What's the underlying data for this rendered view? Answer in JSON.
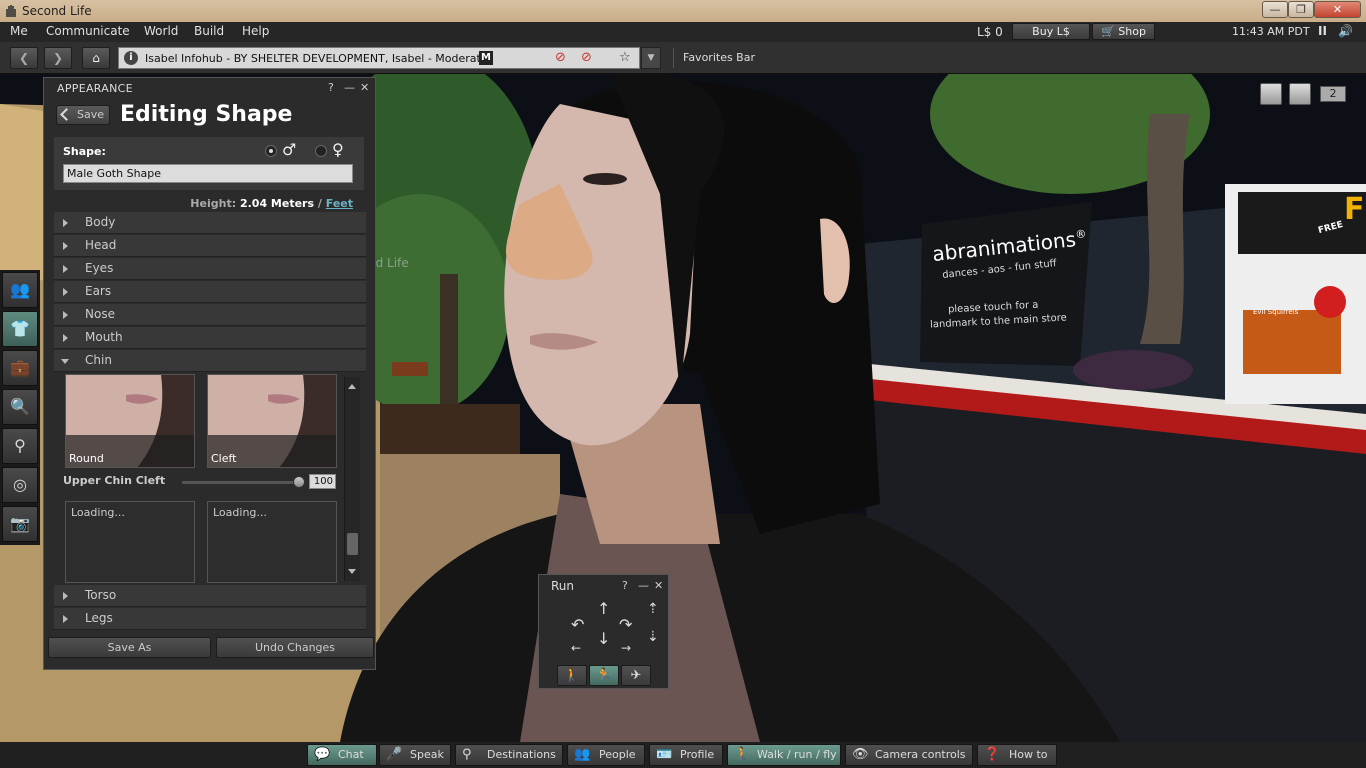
{
  "window": {
    "title": "Second Life",
    "minimize": "—",
    "maximize": "❐",
    "close": "✕"
  },
  "menubar": {
    "items": [
      "Me",
      "Communicate",
      "World",
      "Build",
      "Help"
    ],
    "balance": "L$ 0",
    "buy_label": "Buy L$",
    "shop_label": "Shop",
    "clock": "11:43 AM PDT",
    "pause": "II",
    "volume": "🔊"
  },
  "navbar": {
    "location": "Isabel Infohub - BY SHELTER DEVELOPMENT, Isabel - Moderate",
    "rating": "M",
    "favorites": "Favorites Bar"
  },
  "appearance": {
    "panel_title": "APPEARANCE",
    "help": "?",
    "minimize": "—",
    "close": "✕",
    "save_label": "Save",
    "editing_title": "Editing Shape",
    "shape_label": "Shape:",
    "male_symbol": "♂",
    "female_symbol": "♀",
    "shape_name": "Male Goth Shape",
    "height_label": "Height:",
    "height_value": "2.04 Meters",
    "height_sep": "/",
    "feet_link": "Feet",
    "sections": [
      "Body",
      "Head",
      "Eyes",
      "Ears",
      "Nose",
      "Mouth",
      "Chin"
    ],
    "chin": {
      "thumb_left": "Round",
      "thumb_right": "Cleft",
      "slider_label": "Upper Chin Cleft",
      "slider_value": "100",
      "slider_fraction": 1.0,
      "loading_left": "Loading...",
      "loading_right": "Loading..."
    },
    "sections_after": [
      "Torso",
      "Legs"
    ],
    "save_as": "Save As",
    "undo": "Undo Changes"
  },
  "run_panel": {
    "title": "Run",
    "help": "?",
    "minimize": "—",
    "close": "✕"
  },
  "world": {
    "sign_brand": "abranimations",
    "sign_reg": "®",
    "sign_tagline": "dances - aos - fun stuff",
    "sign_touch1": "please touch for a",
    "sign_touch2": "landmark to the main store",
    "free_badge": "FREE",
    "poster_caption": "Evil Squirrels",
    "edge_letter": "F",
    "faded_text": "nd Life",
    "count": "2"
  },
  "tray": {
    "chat": "Chat",
    "speak": "Speak",
    "destinations": "Destinations",
    "people": "People",
    "profile": "Profile",
    "walk": "Walk / run / fly",
    "camera": "Camera controls",
    "howto": "How to"
  }
}
